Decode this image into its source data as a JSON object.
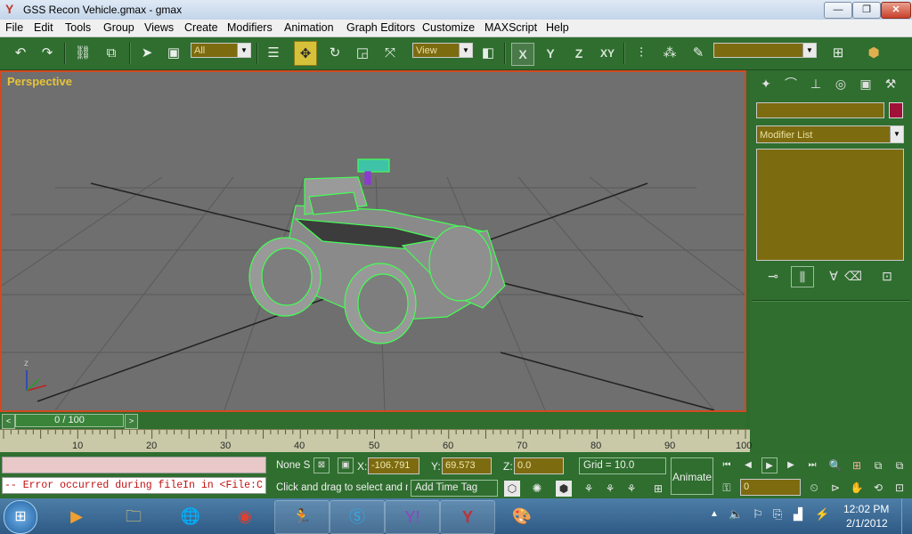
{
  "window": {
    "title": "GSS Recon Vehicle.gmax - gmax",
    "btn_min": "—",
    "btn_max": "❐",
    "btn_close": "✕"
  },
  "menu": [
    "File",
    "Edit",
    "Tools",
    "Group",
    "Views",
    "Create",
    "Modifiers",
    "Animation",
    "Graph Editors",
    "Customize",
    "MAXScript",
    "Help"
  ],
  "toolbar": {
    "selection_filter": "All",
    "ref_coord": "View",
    "axes": [
      "X",
      "Y",
      "Z",
      "XY"
    ],
    "named_selection": ""
  },
  "viewport": {
    "label": "Perspective",
    "gizmo_z": "z"
  },
  "command_panel": {
    "object_name": "",
    "modifier_list": "Modifier List",
    "color_swatch": "#a01038"
  },
  "timeline": {
    "frame_label": "0 / 100",
    "ticks": [
      "10",
      "20",
      "30",
      "40",
      "50",
      "60",
      "70",
      "80",
      "90",
      "100"
    ]
  },
  "status": {
    "maxscript_error": "-- Error occurred during fileIn in <File:C",
    "selection": "None S",
    "x_label": "X:",
    "x_value": "-106.791",
    "y_label": "Y:",
    "y_value": "69.573",
    "z_label": "Z:",
    "z_value": "0.0",
    "grid": "Grid = 10.0",
    "prompt": "Click and drag to select and m",
    "time_tag": "Add Time Tag",
    "animate": "Animate",
    "frame_field": "0"
  },
  "taskbar": {
    "time": "12:02 PM",
    "date": "2/1/2012"
  },
  "colors": {
    "panel_green": "#2f6e2f",
    "field_olive": "#7d6b10",
    "viewport_grey": "#6f6f6f",
    "active_border": "#d24a1f",
    "wire_green": "#44ff55"
  }
}
